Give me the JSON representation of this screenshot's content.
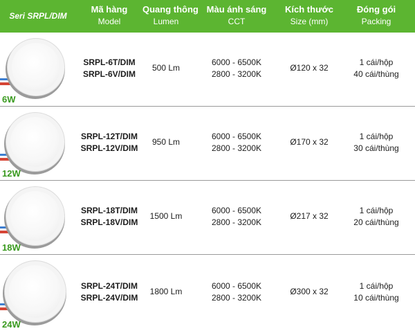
{
  "header": {
    "series": "Seri SRPL/DIM",
    "columns": [
      {
        "vi": "Mã hàng",
        "en": "Model"
      },
      {
        "vi": "Quang thông",
        "en": "Lumen"
      },
      {
        "vi": "Màu ánh sáng",
        "en": "CCT"
      },
      {
        "vi": "Kích thước",
        "en": "Size (mm)"
      },
      {
        "vi": "Đóng gói",
        "en": "Packing"
      }
    ]
  },
  "rows": [
    {
      "watt": "6W",
      "model1": "SRPL-6T/DIM",
      "model2": "SRPL-6V/DIM",
      "lumen": "500 Lm",
      "cct1": "6000 - 6500K",
      "cct2": "2800 - 3200K",
      "size": "Ø120 x 32",
      "pack1": "1 cái/hộp",
      "pack2": "40 cái/thùng"
    },
    {
      "watt": "12W",
      "model1": "SRPL-12T/DIM",
      "model2": "SRPL-12V/DIM",
      "lumen": "950 Lm",
      "cct1": "6000 - 6500K",
      "cct2": "2800 - 3200K",
      "size": "Ø170 x 32",
      "pack1": "1 cái/hộp",
      "pack2": "30 cái/thùng"
    },
    {
      "watt": "18W",
      "model1": "SRPL-18T/DIM",
      "model2": "SRPL-18V/DIM",
      "lumen": "1500 Lm",
      "cct1": "6000 - 6500K",
      "cct2": "2800 - 3200K",
      "size": "Ø217 x 32",
      "pack1": "1 cái/hộp",
      "pack2": "20 cái/thùng"
    },
    {
      "watt": "24W",
      "model1": "SRPL-24T/DIM",
      "model2": "SRPL-24V/DIM",
      "lumen": "1800 Lm",
      "cct1": "6000 - 6500K",
      "cct2": "2800 - 3200K",
      "size": "Ø300 x 32",
      "pack1": "1 cái/hộp",
      "pack2": "10 cái/thùng"
    }
  ],
  "colors": {
    "header_bg": "#5cb531",
    "watt_label": "#3a9a1f"
  }
}
